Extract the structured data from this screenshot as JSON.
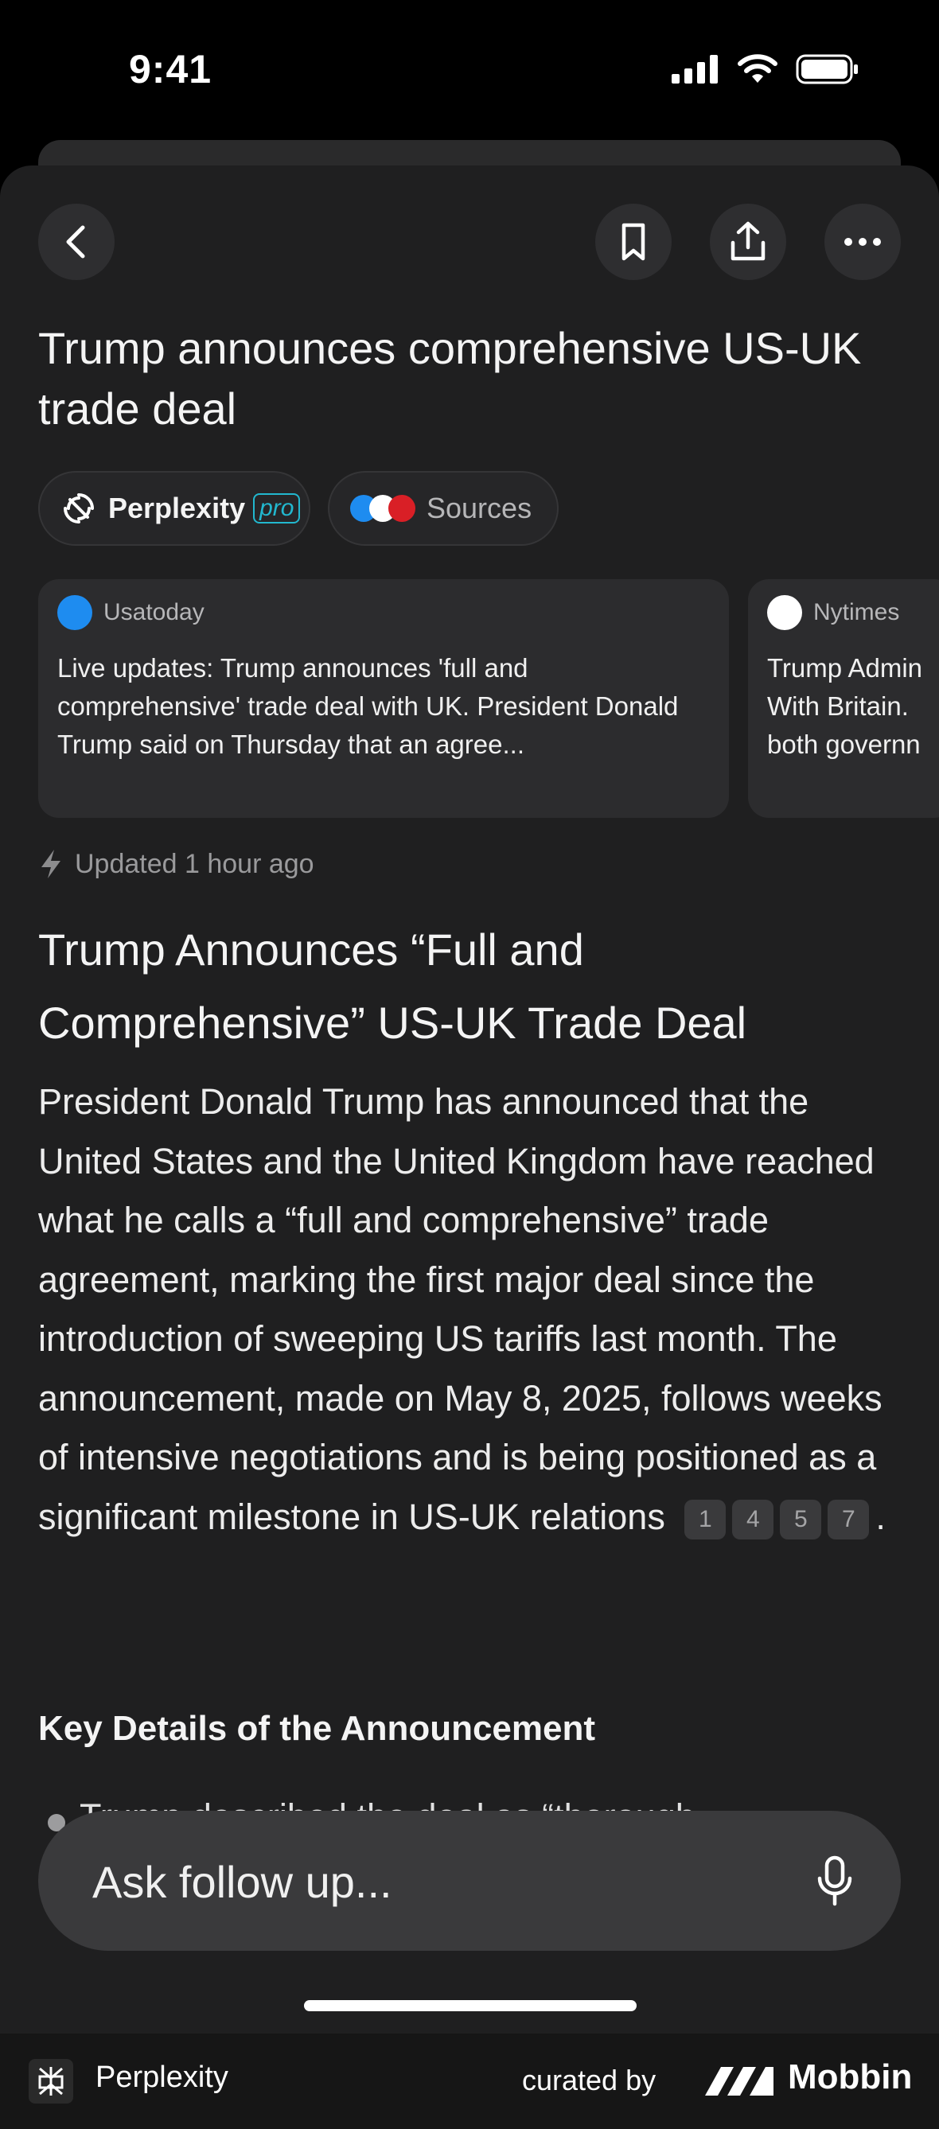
{
  "status_bar": {
    "time": "9:41"
  },
  "article": {
    "title": "Trump announces comprehensive US-UK trade deal",
    "pills": {
      "perplexity_label": "Perplexity",
      "pro_label": "pro",
      "sources_label": "Sources"
    },
    "source_cards": [
      {
        "source": "Usatoday",
        "text": "Live updates: Trump announces 'full and comprehensive' trade deal with UK. President Donald Trump said on Thursday that an agree..."
      },
      {
        "source": "Nytimes",
        "text": "Trump Admin With Britain. both governn"
      }
    ],
    "updated": "Updated 1 hour ago",
    "heading": "Trump Announces “Full and Comprehensive” US-UK Trade Deal",
    "body": "President Donald Trump has announced that the United States and the United Kingdom have reached what he calls a “full and comprehensive” trade agreement, marking the first major deal since the introduction of sweeping US tariffs last month. The announcement, made on May 8, 2025, follows weeks of intensive negotiations and is being positioned as a significant milestone in US-UK relations",
    "citations": [
      "1",
      "4",
      "5",
      "7"
    ],
    "section_title": "Key Details of the Announcement",
    "bullet_peek": "Trump described the deal as “thorough"
  },
  "ask": {
    "placeholder": "Ask follow up..."
  },
  "footer": {
    "brand": "Perplexity",
    "curated_by": "curated by",
    "mobbin": "Mobbin"
  }
}
